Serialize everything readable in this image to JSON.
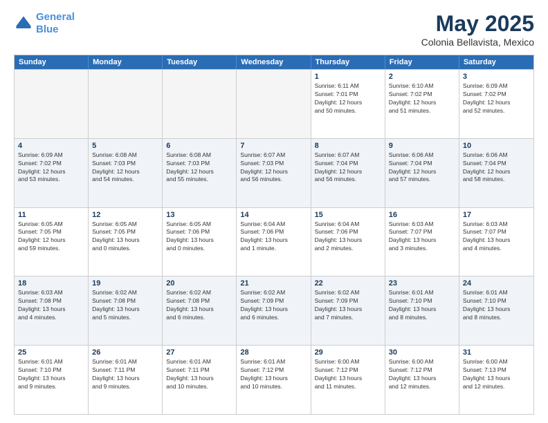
{
  "logo": {
    "line1": "General",
    "line2": "Blue"
  },
  "title": "May 2025",
  "subtitle": "Colonia Bellavista, Mexico",
  "days": [
    "Sunday",
    "Monday",
    "Tuesday",
    "Wednesday",
    "Thursday",
    "Friday",
    "Saturday"
  ],
  "weeks": [
    [
      {
        "day": "",
        "info": ""
      },
      {
        "day": "",
        "info": ""
      },
      {
        "day": "",
        "info": ""
      },
      {
        "day": "",
        "info": ""
      },
      {
        "day": "1",
        "info": "Sunrise: 6:11 AM\nSunset: 7:01 PM\nDaylight: 12 hours\nand 50 minutes."
      },
      {
        "day": "2",
        "info": "Sunrise: 6:10 AM\nSunset: 7:02 PM\nDaylight: 12 hours\nand 51 minutes."
      },
      {
        "day": "3",
        "info": "Sunrise: 6:09 AM\nSunset: 7:02 PM\nDaylight: 12 hours\nand 52 minutes."
      }
    ],
    [
      {
        "day": "4",
        "info": "Sunrise: 6:09 AM\nSunset: 7:02 PM\nDaylight: 12 hours\nand 53 minutes."
      },
      {
        "day": "5",
        "info": "Sunrise: 6:08 AM\nSunset: 7:03 PM\nDaylight: 12 hours\nand 54 minutes."
      },
      {
        "day": "6",
        "info": "Sunrise: 6:08 AM\nSunset: 7:03 PM\nDaylight: 12 hours\nand 55 minutes."
      },
      {
        "day": "7",
        "info": "Sunrise: 6:07 AM\nSunset: 7:03 PM\nDaylight: 12 hours\nand 56 minutes."
      },
      {
        "day": "8",
        "info": "Sunrise: 6:07 AM\nSunset: 7:04 PM\nDaylight: 12 hours\nand 56 minutes."
      },
      {
        "day": "9",
        "info": "Sunrise: 6:06 AM\nSunset: 7:04 PM\nDaylight: 12 hours\nand 57 minutes."
      },
      {
        "day": "10",
        "info": "Sunrise: 6:06 AM\nSunset: 7:04 PM\nDaylight: 12 hours\nand 58 minutes."
      }
    ],
    [
      {
        "day": "11",
        "info": "Sunrise: 6:05 AM\nSunset: 7:05 PM\nDaylight: 12 hours\nand 59 minutes."
      },
      {
        "day": "12",
        "info": "Sunrise: 6:05 AM\nSunset: 7:05 PM\nDaylight: 13 hours\nand 0 minutes."
      },
      {
        "day": "13",
        "info": "Sunrise: 6:05 AM\nSunset: 7:06 PM\nDaylight: 13 hours\nand 0 minutes."
      },
      {
        "day": "14",
        "info": "Sunrise: 6:04 AM\nSunset: 7:06 PM\nDaylight: 13 hours\nand 1 minute."
      },
      {
        "day": "15",
        "info": "Sunrise: 6:04 AM\nSunset: 7:06 PM\nDaylight: 13 hours\nand 2 minutes."
      },
      {
        "day": "16",
        "info": "Sunrise: 6:03 AM\nSunset: 7:07 PM\nDaylight: 13 hours\nand 3 minutes."
      },
      {
        "day": "17",
        "info": "Sunrise: 6:03 AM\nSunset: 7:07 PM\nDaylight: 13 hours\nand 4 minutes."
      }
    ],
    [
      {
        "day": "18",
        "info": "Sunrise: 6:03 AM\nSunset: 7:08 PM\nDaylight: 13 hours\nand 4 minutes."
      },
      {
        "day": "19",
        "info": "Sunrise: 6:02 AM\nSunset: 7:08 PM\nDaylight: 13 hours\nand 5 minutes."
      },
      {
        "day": "20",
        "info": "Sunrise: 6:02 AM\nSunset: 7:08 PM\nDaylight: 13 hours\nand 6 minutes."
      },
      {
        "day": "21",
        "info": "Sunrise: 6:02 AM\nSunset: 7:09 PM\nDaylight: 13 hours\nand 6 minutes."
      },
      {
        "day": "22",
        "info": "Sunrise: 6:02 AM\nSunset: 7:09 PM\nDaylight: 13 hours\nand 7 minutes."
      },
      {
        "day": "23",
        "info": "Sunrise: 6:01 AM\nSunset: 7:10 PM\nDaylight: 13 hours\nand 8 minutes."
      },
      {
        "day": "24",
        "info": "Sunrise: 6:01 AM\nSunset: 7:10 PM\nDaylight: 13 hours\nand 8 minutes."
      }
    ],
    [
      {
        "day": "25",
        "info": "Sunrise: 6:01 AM\nSunset: 7:10 PM\nDaylight: 13 hours\nand 9 minutes."
      },
      {
        "day": "26",
        "info": "Sunrise: 6:01 AM\nSunset: 7:11 PM\nDaylight: 13 hours\nand 9 minutes."
      },
      {
        "day": "27",
        "info": "Sunrise: 6:01 AM\nSunset: 7:11 PM\nDaylight: 13 hours\nand 10 minutes."
      },
      {
        "day": "28",
        "info": "Sunrise: 6:01 AM\nSunset: 7:12 PM\nDaylight: 13 hours\nand 10 minutes."
      },
      {
        "day": "29",
        "info": "Sunrise: 6:00 AM\nSunset: 7:12 PM\nDaylight: 13 hours\nand 11 minutes."
      },
      {
        "day": "30",
        "info": "Sunrise: 6:00 AM\nSunset: 7:12 PM\nDaylight: 13 hours\nand 12 minutes."
      },
      {
        "day": "31",
        "info": "Sunrise: 6:00 AM\nSunset: 7:13 PM\nDaylight: 13 hours\nand 12 minutes."
      }
    ]
  ]
}
